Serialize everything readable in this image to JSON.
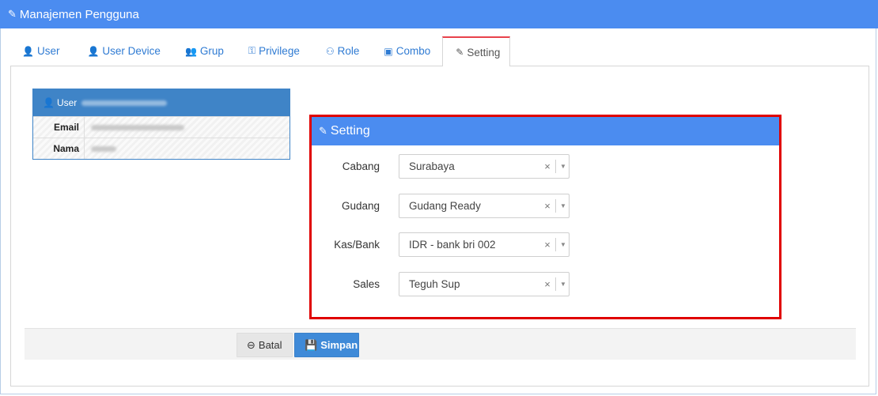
{
  "window": {
    "title": "Manajemen Pengguna",
    "title_icon": "✎"
  },
  "tabs": [
    {
      "label": "User",
      "icon": "👤"
    },
    {
      "label": "User Device",
      "icon": "👤"
    },
    {
      "label": "Grup",
      "icon": "👥"
    },
    {
      "label": "Privilege",
      "icon": "⚿"
    },
    {
      "label": "Role",
      "icon": "⚇"
    },
    {
      "label": "Combo",
      "icon": "▣"
    },
    {
      "label": "Setting",
      "icon": "✎"
    }
  ],
  "active_tab": "Setting",
  "user_card": {
    "header_label": "User",
    "header_icon": "👤",
    "rows": [
      {
        "key": "Email"
      },
      {
        "key": "Nama"
      }
    ]
  },
  "setting": {
    "title": "Setting",
    "title_icon": "✎",
    "fields": [
      {
        "label": "Cabang",
        "value": "Surabaya"
      },
      {
        "label": "Gudang",
        "value": "Gudang Ready"
      },
      {
        "label": "Kas/Bank",
        "value": "IDR - bank bri 002"
      },
      {
        "label": "Sales",
        "value": "Teguh Sup"
      }
    ],
    "clear_glyph": "×",
    "dropdown_glyph": "▼"
  },
  "footer": {
    "cancel_label": "Batal",
    "cancel_icon": "⊖",
    "save_label": "Simpan",
    "save_icon": "💾"
  },
  "colors": {
    "header_blue": "#4b8cf0",
    "card_blue": "#3f84c7",
    "highlight_red": "#e00000",
    "active_tab_accent": "#e8424b",
    "save_button": "#3f8ad8"
  }
}
